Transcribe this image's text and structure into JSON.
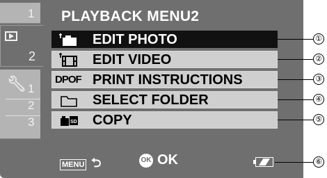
{
  "screen": {
    "title": "PLAYBACK MENU2",
    "tabs": {
      "tab1_number": "1",
      "tab2_number": "2",
      "setup_numbers": [
        "1",
        "2",
        "3"
      ]
    },
    "menu_items": [
      {
        "label": "EDIT PHOTO",
        "icon": "edit-photo-icon",
        "selected": true
      },
      {
        "label": "EDIT VIDEO",
        "icon": "edit-video-icon",
        "selected": false
      },
      {
        "label": "PRINT INSTRUCTIONS",
        "icon": "dpof-icon",
        "icon_text": "DPOF",
        "selected": false
      },
      {
        "label": "SELECT FOLDER",
        "icon": "folder-icon",
        "selected": false
      },
      {
        "label": "COPY",
        "icon": "copy-icon",
        "selected": false
      }
    ],
    "bottom": {
      "menu_key": "MENU",
      "ok_key": "OK",
      "ok_label": "OK",
      "battery_icon": "battery-icon"
    }
  },
  "callouts": [
    "①",
    "②",
    "③",
    "④",
    "⑤",
    "⑥"
  ],
  "colors": {
    "screen_bg": "#6f6f6f",
    "selected_bg": "#111111",
    "item_bg": "#cfcfcf"
  }
}
